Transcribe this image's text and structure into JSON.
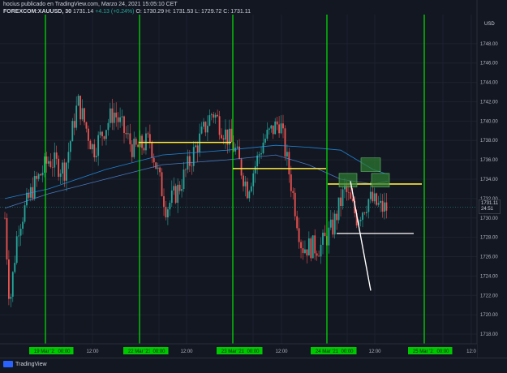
{
  "header": {
    "line1": "hocius publicado en TradingView.com, Marzo 24, 2021 15:05:10 CET",
    "symbol": "FOREXCOM:XAUUSD, 30",
    "price": "1731.14",
    "change": "+4.13 (+0.24%)",
    "ohlc": "O: 1730.29  H: 1731.53  L: 1729.72  C: 1731.11"
  },
  "axis": {
    "currency": "USD",
    "current_price": "1731.11",
    "countdown": "24:51",
    "price_labels": [
      "1748.00",
      "1746.00",
      "1744.00",
      "1742.00",
      "1740.00",
      "1738.00",
      "1736.00",
      "1734.00",
      "1732.00",
      "1730.00",
      "1728.00",
      "1726.00",
      "1724.00",
      "1722.00",
      "1720.00",
      "1718.00"
    ],
    "time_labels": [
      "19 Mar '21",
      "00:00",
      "12:00",
      "22 Mar '21",
      "00:00",
      "12:00",
      "23 Mar '21",
      "00:00",
      "12:00",
      "24 Mar '21",
      "00:00",
      "12:00",
      "25 Mar '21",
      "00:00",
      "12:0"
    ]
  },
  "footer": {
    "brand": "TradingView"
  },
  "colors": {
    "background": "#131722",
    "up": "#26a69a",
    "down": "#ef5350",
    "vline": "#00e600",
    "hline": "#ffeb3b",
    "ma": "#2196f3"
  },
  "chart_data": {
    "type": "candlestick",
    "instrument": "FOREXCOM:XAUUSD",
    "interval": "30",
    "ylim": [
      1717,
      1751
    ],
    "price_levels": [
      1748,
      1746,
      1744,
      1742,
      1740,
      1738,
      1736,
      1734,
      1732,
      1730,
      1728,
      1726,
      1724,
      1722,
      1720,
      1718
    ],
    "session_starts": [
      "19 Mar '21",
      "22 Mar '21",
      "23 Mar '21",
      "24 Mar '21",
      "25 Mar '21"
    ],
    "current_price": 1731.11
  }
}
